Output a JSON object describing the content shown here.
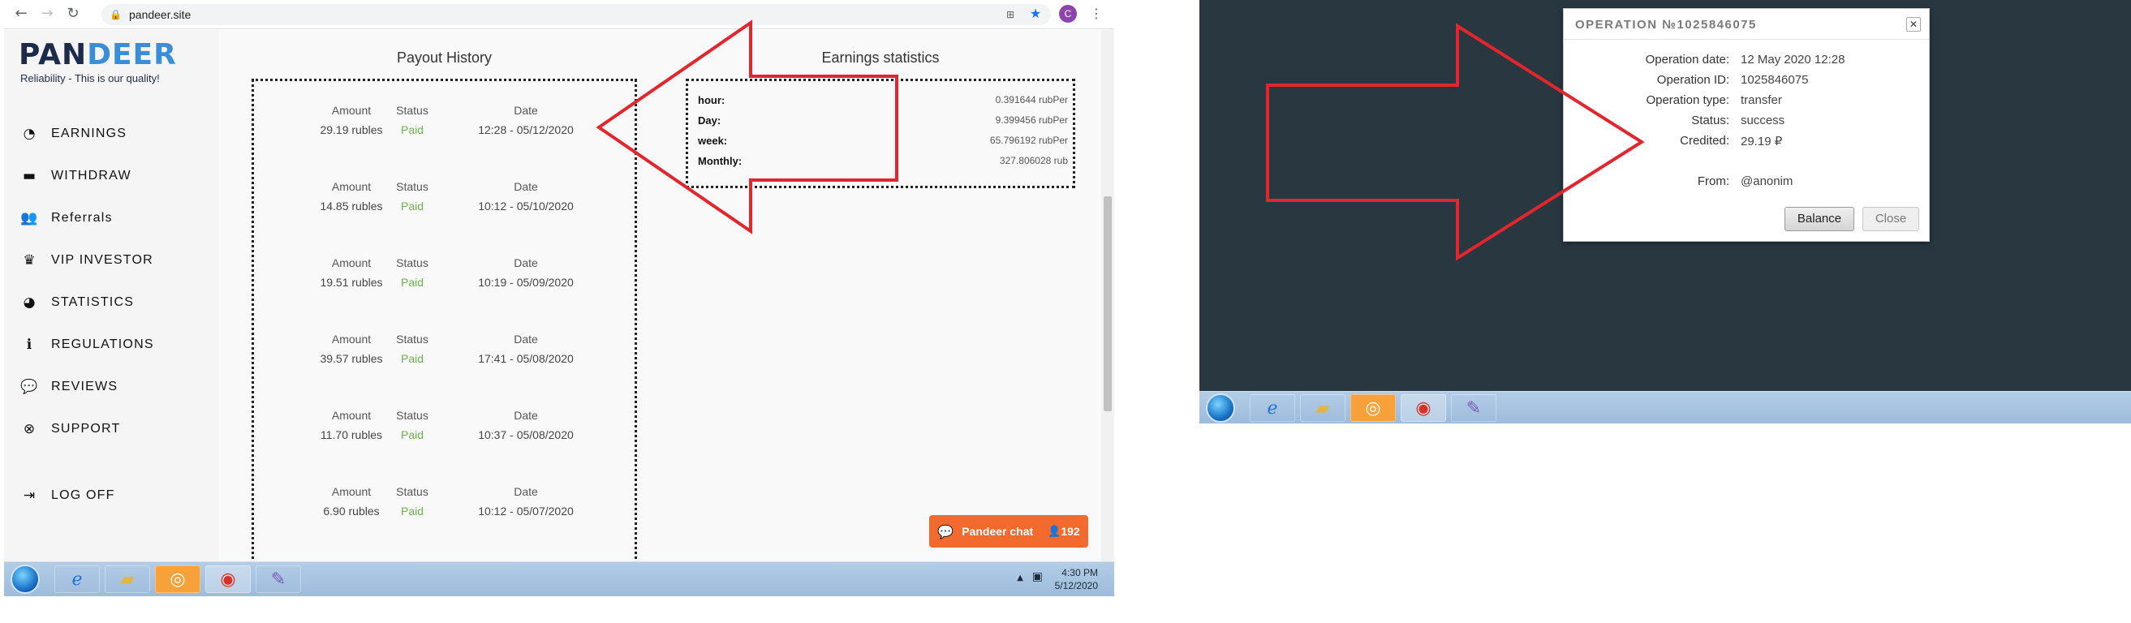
{
  "browser": {
    "url": "pandeer.site",
    "profile_initial": "C",
    "icons": {
      "back": "arrow-left-icon",
      "forward": "arrow-right-icon",
      "reload": "reload-icon",
      "lock": "lock-icon",
      "translate": "translate-icon",
      "bookmark": "star-icon",
      "menu": "vertical-dots-icon"
    }
  },
  "site": {
    "logo_part1": "PAN",
    "logo_part2": "DEER",
    "tagline": "Reliability - This is our quality!",
    "colors": {
      "brand_dark": "#1d2b4a",
      "brand_blue": "#3a8ed8",
      "paid_green": "#6ab04c",
      "chat_orange": "#f26a2d"
    }
  },
  "sidebar": {
    "items": [
      {
        "label": "EARNINGS",
        "icon": "gauge-icon"
      },
      {
        "label": "WITHDRAW",
        "icon": "minus-square-icon"
      },
      {
        "label": "Referrals",
        "icon": "users-icon"
      },
      {
        "label": "VIP INVESTOR",
        "icon": "crown-icon"
      },
      {
        "label": "STATISTICS",
        "icon": "pie-chart-icon"
      },
      {
        "label": "REGULATIONS",
        "icon": "info-icon"
      },
      {
        "label": "REVIEWS",
        "icon": "comments-icon"
      },
      {
        "label": "SUPPORT",
        "icon": "lifebuoy-icon"
      }
    ],
    "logout": {
      "label": "LOG OFF",
      "icon": "sign-out-icon"
    }
  },
  "payout": {
    "title": "Payout History",
    "headers": {
      "amount": "Amount",
      "status": "Status",
      "date": "Date"
    },
    "rows": [
      {
        "amount": "29.19 rubles",
        "status": "Paid",
        "date": "12:28 - 05/12/2020"
      },
      {
        "amount": "14.85 rubles",
        "status": "Paid",
        "date": "10:12 - 05/10/2020"
      },
      {
        "amount": "19.51 rubles",
        "status": "Paid",
        "date": "10:19 - 05/09/2020"
      },
      {
        "amount": "39.57 rubles",
        "status": "Paid",
        "date": "17:41 - 05/08/2020"
      },
      {
        "amount": "11.70 rubles",
        "status": "Paid",
        "date": "10:37 - 05/08/2020"
      },
      {
        "amount": "6.90 rubles",
        "status": "Paid",
        "date": "10:12 - 05/07/2020"
      }
    ]
  },
  "earnings": {
    "title": "Earnings statistics",
    "rows": [
      {
        "label": "hour:",
        "value": "0.391644 rubPer"
      },
      {
        "label": "Day:",
        "value": "9.399456 rubPer"
      },
      {
        "label": "week:",
        "value": "65.796192 rubPer"
      },
      {
        "label": "Monthly:",
        "value": "327.806028 rub"
      }
    ]
  },
  "chat": {
    "label": "Pandeer chat",
    "count": "192",
    "icon": "chat-bubble-icon",
    "user_icon": "user-icon"
  },
  "taskbar_left": {
    "time": "4:30 PM",
    "date": "5/12/2020",
    "apps": [
      "ie-icon",
      "folder-icon",
      "qiwi-icon",
      "chrome-icon",
      "paint-icon"
    ]
  },
  "dialog": {
    "title": "OPERATION №1025846075",
    "fields": [
      {
        "label": "Operation date:",
        "value": "12 May 2020 12:28"
      },
      {
        "label": "Operation ID:",
        "value": "1025846075"
      },
      {
        "label": "Operation type:",
        "value": "transfer"
      },
      {
        "label": "Status:",
        "value": "success"
      },
      {
        "label": "Credited:",
        "value": "29.19 ₽"
      }
    ],
    "from_label": "From:",
    "from_value": "@anonim",
    "balance_button": "Balance",
    "close_button": "Close"
  },
  "annotation": {
    "arrow_color": "#e3262d"
  }
}
